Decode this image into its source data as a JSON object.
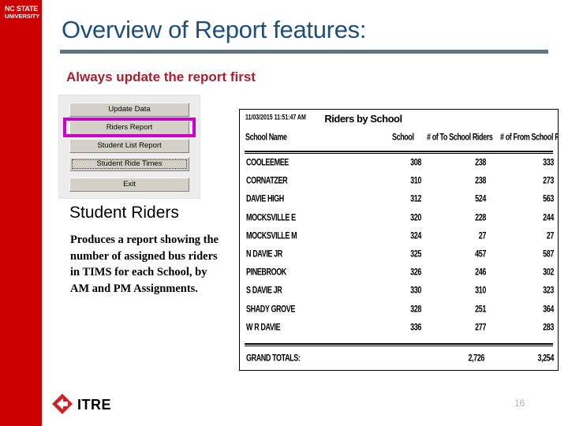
{
  "branding": {
    "university_line1": "NC STATE",
    "university_line2": "UNIVERSITY",
    "sidebar_color": "#cc0000",
    "itre_label": "ITRE",
    "itre_mark_color": "#cc2229"
  },
  "slide": {
    "title": "Overview of Report features:",
    "title_color": "#1f4e79",
    "rule_color": "#5f7582",
    "subtitle": "Always update the report first",
    "subtitle_color": "#b01c2e",
    "page_number": "16"
  },
  "app_panel": {
    "name": "riders-report-button-panel",
    "highlight_color": "#cc00cc",
    "buttons": [
      {
        "label": "Update Data",
        "state": "normal"
      },
      {
        "label": "Riders Report",
        "state": "highlighted"
      },
      {
        "label": "Student List Report",
        "state": "normal"
      },
      {
        "label": "Student Ride Times",
        "state": "focused"
      },
      {
        "label": "Exit",
        "state": "normal"
      }
    ]
  },
  "description": {
    "heading": "Student Riders",
    "text": "Produces a report showing the number of assigned bus riders in TIMS for each School, by AM and PM Assignments."
  },
  "report": {
    "timestamp": "11/03/2015 11:51:47 AM",
    "title": "Riders by School",
    "columns": [
      "School Name",
      "School",
      "# of To School Riders",
      "# of From School Riders"
    ],
    "rows": [
      {
        "school_name": "COOLEEMEE",
        "school": "308",
        "to_riders": "238",
        "from_riders": "333"
      },
      {
        "school_name": "CORNATZER",
        "school": "310",
        "to_riders": "238",
        "from_riders": "273"
      },
      {
        "school_name": "DAVIE HIGH",
        "school": "312",
        "to_riders": "524",
        "from_riders": "563"
      },
      {
        "school_name": "MOCKSVILLE E",
        "school": "320",
        "to_riders": "228",
        "from_riders": "244"
      },
      {
        "school_name": "MOCKSVILLE M",
        "school": "324",
        "to_riders": "27",
        "from_riders": "27"
      },
      {
        "school_name": "N DAVIE JR",
        "school": "325",
        "to_riders": "457",
        "from_riders": "587"
      },
      {
        "school_name": "PINEBROOK",
        "school": "326",
        "to_riders": "246",
        "from_riders": "302"
      },
      {
        "school_name": "S DAVIE JR",
        "school": "330",
        "to_riders": "310",
        "from_riders": "323"
      },
      {
        "school_name": "SHADY GROVE",
        "school": "328",
        "to_riders": "251",
        "from_riders": "364"
      },
      {
        "school_name": "W R DAVIE",
        "school": "336",
        "to_riders": "277",
        "from_riders": "283"
      }
    ],
    "totals": {
      "label": "GRAND TOTALS:",
      "to_riders": "2,726",
      "from_riders": "3,254"
    }
  }
}
